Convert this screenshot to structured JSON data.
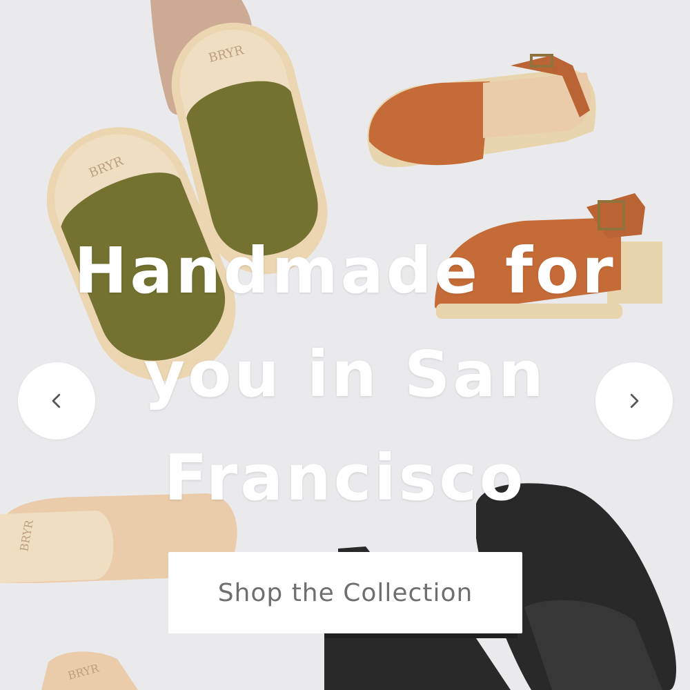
{
  "hero": {
    "headline": "Handmade for you in San Francisco",
    "cta_label": "Shop the Collection",
    "image": {
      "alt": "Assorted handmade clogs on a light background",
      "brand_stamp": "BRYR",
      "colors": {
        "background": "#e9e9ec",
        "olive_suede": "#6b6a24",
        "cognac_leather": "#c2622b",
        "natural_leather": "#e9c9a6",
        "black_leather": "#1c1c1c",
        "wood_sole": "#e8d3a8"
      }
    },
    "prev_icon": "chevron-left-icon",
    "next_icon": "chevron-right-icon"
  }
}
